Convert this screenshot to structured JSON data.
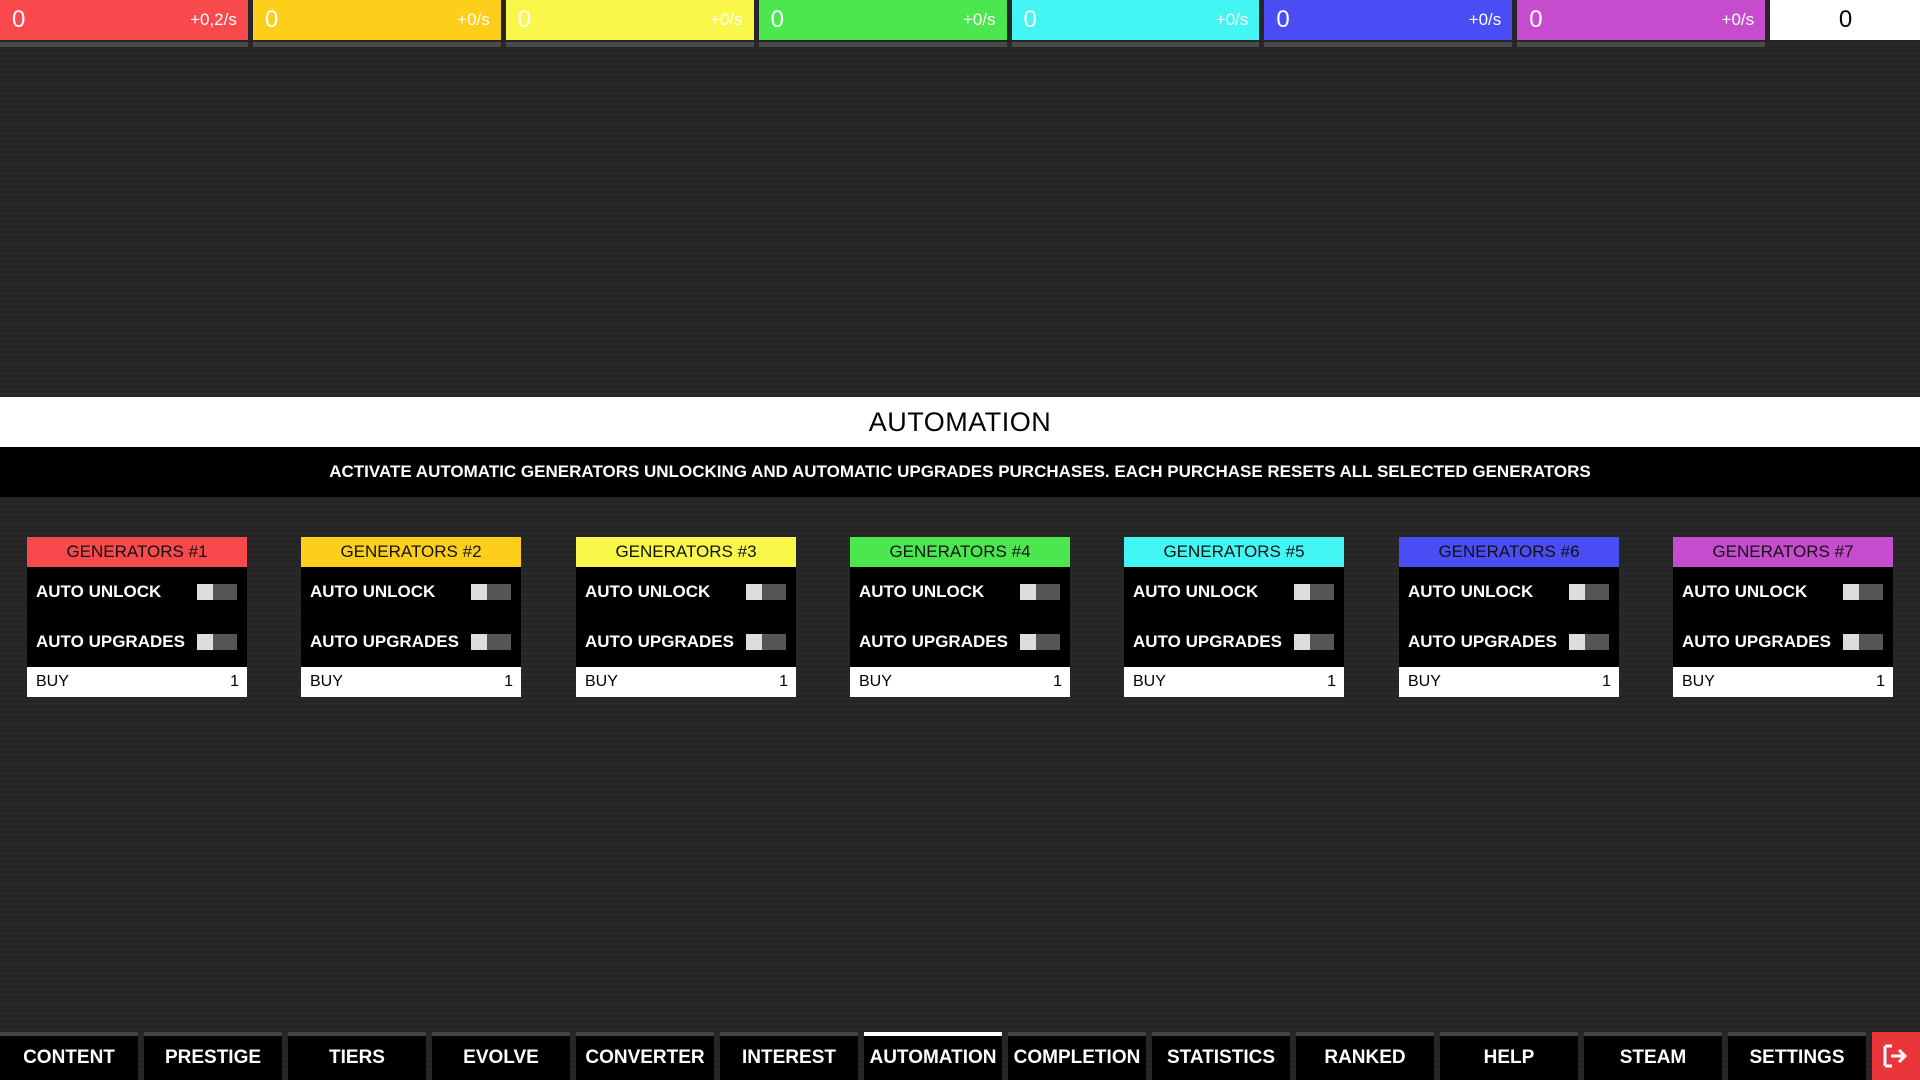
{
  "resources": [
    {
      "amount": "0",
      "rate": "+0,2/s",
      "color": "#f8494d"
    },
    {
      "amount": "0",
      "rate": "+0/s",
      "color": "#fdcf1a"
    },
    {
      "amount": "0",
      "rate": "+0/s",
      "color": "#f9f74a"
    },
    {
      "amount": "0",
      "rate": "+0/s",
      "color": "#4ce64f"
    },
    {
      "amount": "0",
      "rate": "+0/s",
      "color": "#43f6f4"
    },
    {
      "amount": "0",
      "rate": "+0/s",
      "color": "#4a4cf4"
    },
    {
      "amount": "0",
      "rate": "+0/s",
      "color": "#c64cce"
    }
  ],
  "resource_total": "0",
  "section": {
    "title": "AUTOMATION",
    "description": "ACTIVATE AUTOMATIC GENERATORS UNLOCKING AND AUTOMATIC UPGRADES PURCHASES. EACH PURCHASE RESETS ALL SELECTED GENERATORS"
  },
  "generators": [
    {
      "title": "GENERATORS #1",
      "color": "#f8494d",
      "auto_unlock": "AUTO UNLOCK",
      "auto_upgrades": "AUTO UPGRADES",
      "buy_label": "BUY",
      "buy_cost": "1"
    },
    {
      "title": "GENERATORS #2",
      "color": "#fdcf1a",
      "auto_unlock": "AUTO UNLOCK",
      "auto_upgrades": "AUTO UPGRADES",
      "buy_label": "BUY",
      "buy_cost": "1"
    },
    {
      "title": "GENERATORS #3",
      "color": "#f9f74a",
      "auto_unlock": "AUTO UNLOCK",
      "auto_upgrades": "AUTO UPGRADES",
      "buy_label": "BUY",
      "buy_cost": "1"
    },
    {
      "title": "GENERATORS #4",
      "color": "#4ce64f",
      "auto_unlock": "AUTO UNLOCK",
      "auto_upgrades": "AUTO UPGRADES",
      "buy_label": "BUY",
      "buy_cost": "1"
    },
    {
      "title": "GENERATORS #5",
      "color": "#43f6f4",
      "auto_unlock": "AUTO UNLOCK",
      "auto_upgrades": "AUTO UPGRADES",
      "buy_label": "BUY",
      "buy_cost": "1"
    },
    {
      "title": "GENERATORS #6",
      "color": "#4a4cf4",
      "auto_unlock": "AUTO UNLOCK",
      "auto_upgrades": "AUTO UPGRADES",
      "buy_label": "BUY",
      "buy_cost": "1"
    },
    {
      "title": "GENERATORS #7",
      "color": "#c64cce",
      "auto_unlock": "AUTO UNLOCK",
      "auto_upgrades": "AUTO UPGRADES",
      "buy_label": "BUY",
      "buy_cost": "1"
    }
  ],
  "nav": {
    "tabs": [
      {
        "label": "CONTENT",
        "active": false
      },
      {
        "label": "PRESTIGE",
        "active": false
      },
      {
        "label": "TIERS",
        "active": false
      },
      {
        "label": "EVOLVE",
        "active": false
      },
      {
        "label": "CONVERTER",
        "active": false
      },
      {
        "label": "INTEREST",
        "active": false
      },
      {
        "label": "AUTOMATION",
        "active": true
      },
      {
        "label": "COMPLETION",
        "active": false
      },
      {
        "label": "STATISTICS",
        "active": false
      },
      {
        "label": "RANKED",
        "active": false
      },
      {
        "label": "HELP",
        "active": false
      },
      {
        "label": "STEAM",
        "active": false
      },
      {
        "label": "SETTINGS",
        "active": false
      }
    ],
    "exit_icon": "exit-icon",
    "exit_color": "#e8353a"
  }
}
